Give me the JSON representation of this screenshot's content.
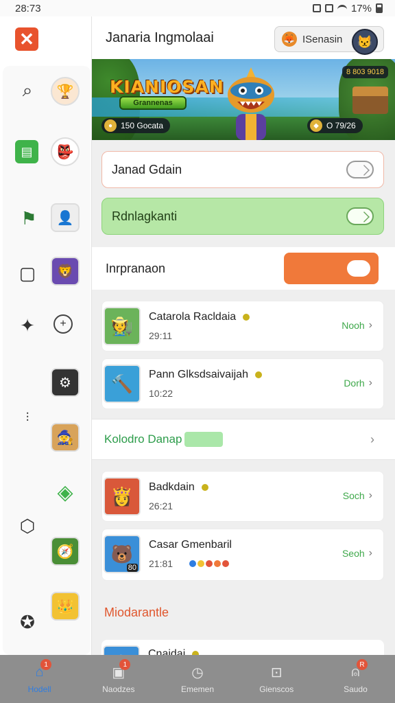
{
  "status_bar": {
    "time": "28:73",
    "battery": "17%"
  },
  "header": {
    "title": "Janaria Ingmolaai",
    "user_pill": "ISenasin"
  },
  "banner": {
    "title": "KIANIOSAN",
    "subtitle": "Grannenas",
    "chip_left": "150 Gocata",
    "chip_right": "O 79/26",
    "level": "8 803 9018"
  },
  "settings": {
    "toggle_a_label": "Janad Gdain",
    "toggle_b_label": "Rdnlagkanti",
    "toggle_c_label": "Inrpranaon"
  },
  "games_top": [
    {
      "name": "Catarola Racldaia",
      "time": "29:11",
      "action": "Nooh",
      "icon": "farmer-character-icon"
    },
    {
      "name": "Pann Glksdsaivaijah",
      "time": "10:22",
      "action": "Dorh",
      "icon": "hammer-game-icon"
    }
  ],
  "section_row": {
    "label": "Kolodro Danap"
  },
  "games_bottom": [
    {
      "name": "Badkdain",
      "time": "26:21",
      "action": "Soch",
      "icon": "heroine-character-icon"
    },
    {
      "name": "Casar Gmenbaril",
      "time": "21:81",
      "action": "Seoh",
      "icon": "bear-character-icon",
      "corner": "80"
    }
  ],
  "section_heading": "Miodarantle",
  "peek_item": {
    "name": "Cnaidai"
  },
  "bottom_nav": [
    {
      "label": "Hodell",
      "icon": "home-icon",
      "active": true,
      "badge": "1"
    },
    {
      "label": "Naodzes",
      "icon": "calendar-icon",
      "active": false,
      "badge": "1"
    },
    {
      "label": "Ememen",
      "icon": "compass-icon",
      "active": false,
      "badge": ""
    },
    {
      "label": "Gienscos",
      "icon": "controller-icon",
      "active": false,
      "badge": ""
    },
    {
      "label": "Saudo",
      "icon": "profile-icon",
      "active": false,
      "badge": "R"
    }
  ],
  "colors": {
    "accent_orange": "#f0793a",
    "close_red": "#e8532d",
    "green": "#3ea84a",
    "nav_active": "#2f7de1"
  }
}
